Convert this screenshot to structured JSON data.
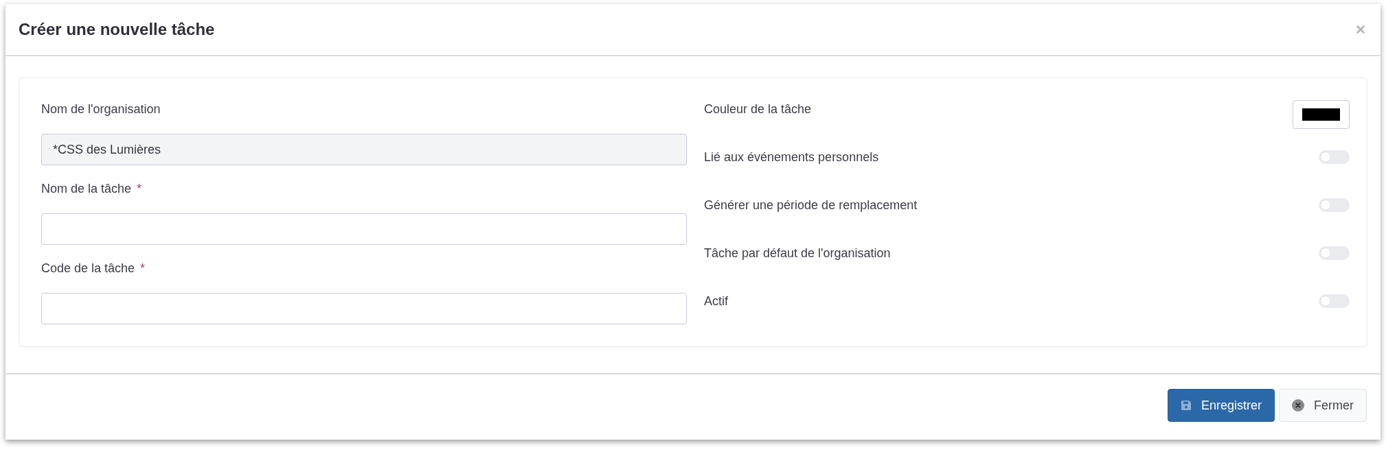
{
  "dialog": {
    "title": "Créer une nouvelle tâche"
  },
  "form": {
    "fields": [
      {
        "label": "Nom de l'organisation",
        "value": "*CSS des Lumières",
        "disabled": true
      },
      {
        "label": "Nom de la tâche",
        "required_mark": "*",
        "disabled": false
      },
      {
        "label": "Code de la tâche",
        "required_mark": "*",
        "disabled": false
      }
    ],
    "options": [
      {
        "kind": "color",
        "label": "Couleur de la tâche",
        "color": "#000000"
      },
      {
        "kind": "toggle",
        "label": "Lié aux événements personnels",
        "on": false
      },
      {
        "kind": "toggle",
        "label": "Générer une période de remplacement",
        "on": false
      },
      {
        "kind": "toggle",
        "label": "Tâche par défaut de l'organisation",
        "on": false
      },
      {
        "kind": "toggle",
        "label": "Actif",
        "on": false
      }
    ]
  },
  "footer": {
    "buttons": [
      {
        "kind": "save",
        "label": "Enregistrer"
      },
      {
        "kind": "close",
        "label": "Fermer"
      }
    ]
  }
}
